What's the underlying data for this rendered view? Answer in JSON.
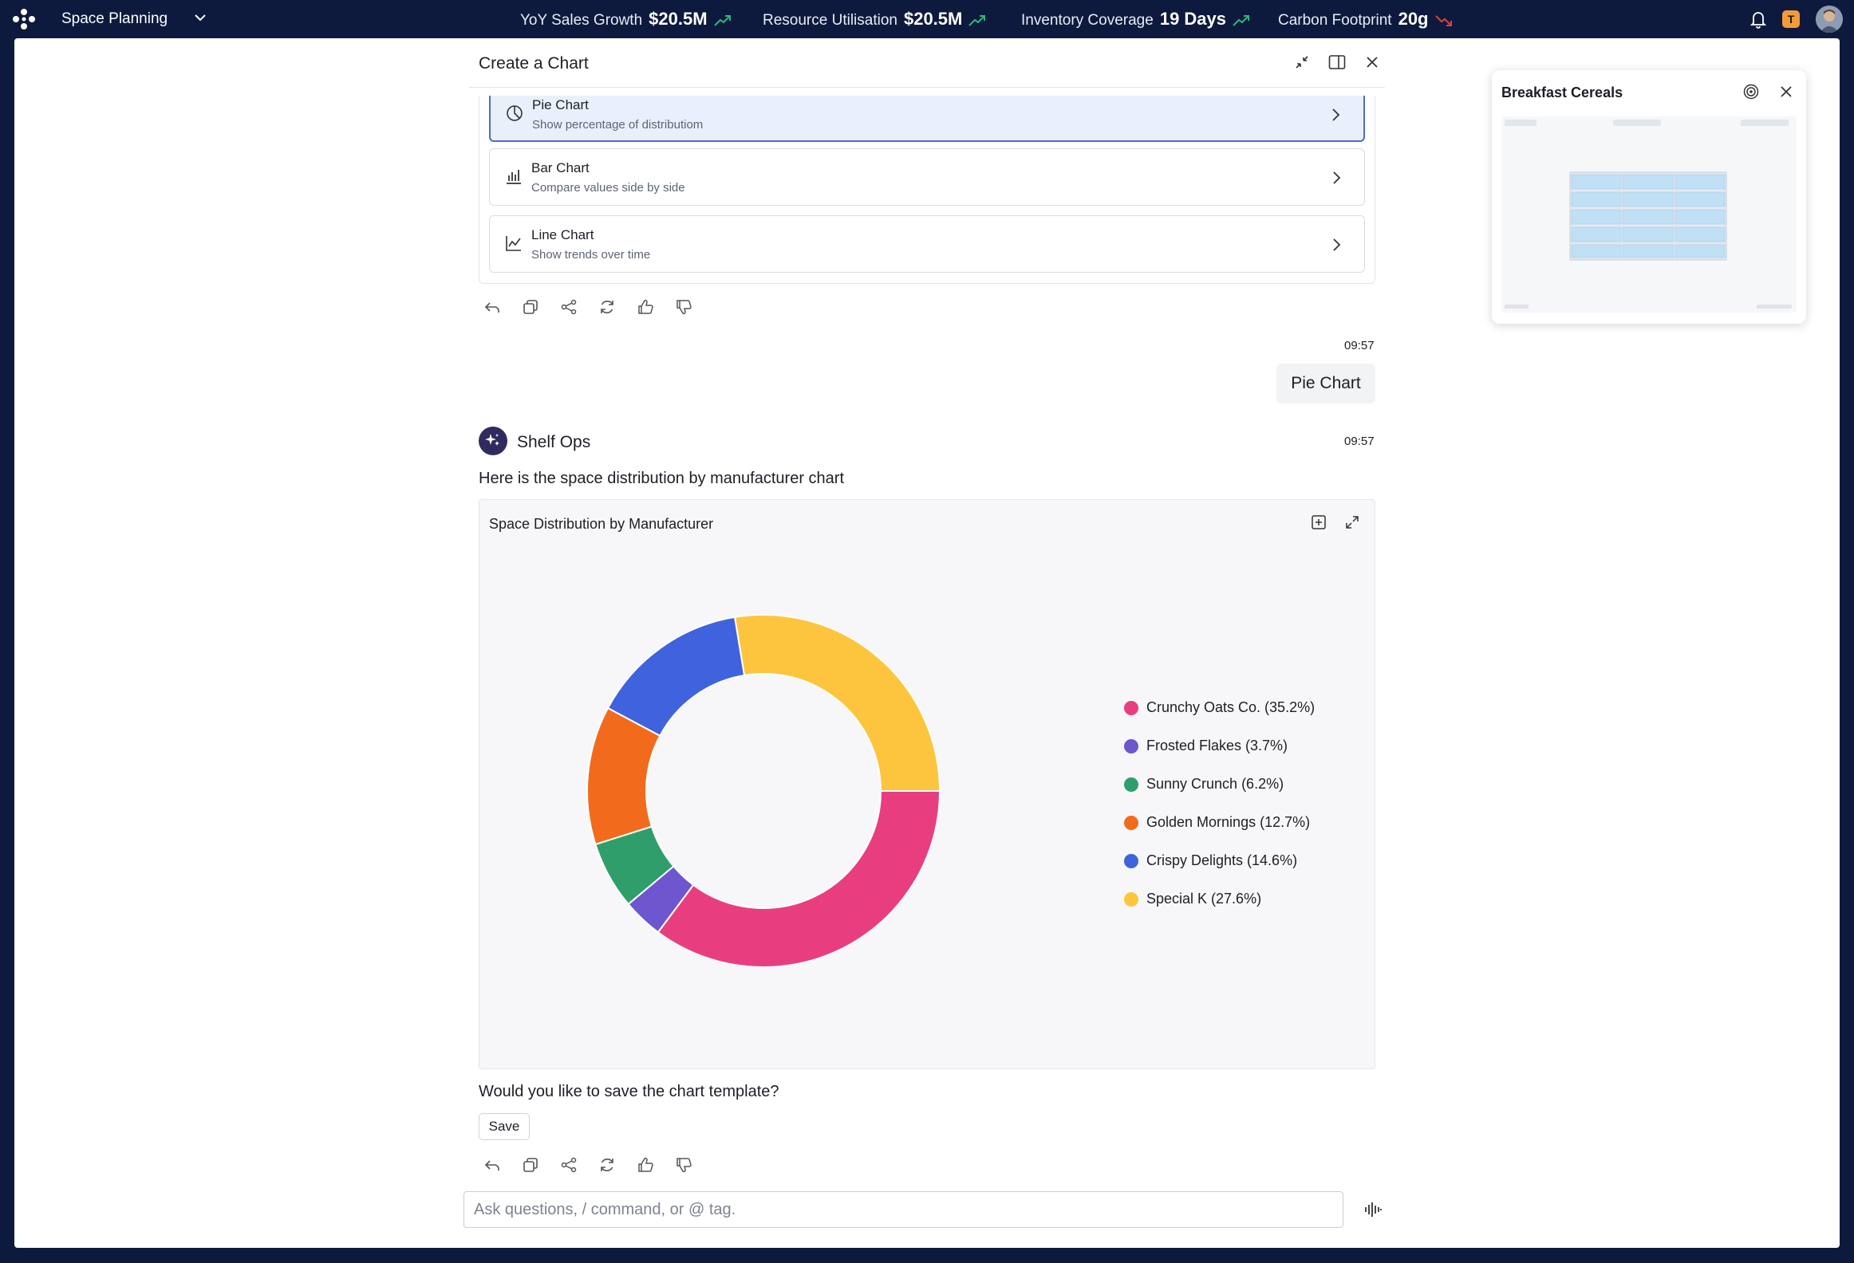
{
  "app": {
    "name": "Space Planning"
  },
  "metrics": [
    {
      "label": "YoY Sales Growth",
      "value": "$20.5M",
      "trend": "up"
    },
    {
      "label": "Resource Utilisation",
      "value": "$20.5M",
      "trend": "up"
    },
    {
      "label": "Inventory Coverage",
      "value": "19 Days",
      "trend": "up"
    },
    {
      "label": "Carbon Footprint",
      "value": "20g",
      "trend": "down"
    }
  ],
  "user": {
    "initial": "T"
  },
  "colors": {
    "nav": "#0e1a3d",
    "trend_up": "#2fb57a",
    "trend_down": "#e0413d",
    "accent": "#4a6bd2"
  },
  "panel": {
    "title": "Create a Chart"
  },
  "options": [
    {
      "title": "Pie Chart",
      "subtitle": "Show percentage of distributiom",
      "icon": "pie-chart-icon",
      "selected": true
    },
    {
      "title": "Bar Chart",
      "subtitle": "Compare values side by side",
      "icon": "bar-chart-icon",
      "selected": false
    },
    {
      "title": "Line Chart",
      "subtitle": "Show trends over time",
      "icon": "line-chart-icon",
      "selected": false
    }
  ],
  "messages": {
    "user_time": "09:57",
    "user_text": "Pie Chart",
    "bot_name": "Shelf Ops",
    "bot_time": "09:57",
    "bot_text": "Here is the space distribution by manufacturer chart",
    "save_question": "Would you like to save the chart template?",
    "save_label": "Save"
  },
  "input": {
    "placeholder": "Ask questions, / command, or @ tag."
  },
  "thumbnail": {
    "title": "Breakfast Cereals"
  },
  "chart_data": {
    "type": "pie",
    "title": "Space Distribution by Manufacturer",
    "legend_position": "right",
    "slices": [
      {
        "label": "Crunchy Oats Co. (35.2%)",
        "value": 35.2,
        "color": "#e83e80"
      },
      {
        "label": "Frosted Flakes (3.7%)",
        "value": 3.7,
        "color": "#6e56cf"
      },
      {
        "label": "Sunny Crunch (6.2%)",
        "value": 6.2,
        "color": "#2f9e6a"
      },
      {
        "label": "Golden Mornings (12.7%)",
        "value": 12.7,
        "color": "#f26b1d"
      },
      {
        "label": "Crispy Delights (14.6%)",
        "value": 14.6,
        "color": "#3f63dd"
      },
      {
        "label": "Special K (27.6%)",
        "value": 27.6,
        "color": "#fdc53e"
      }
    ]
  }
}
